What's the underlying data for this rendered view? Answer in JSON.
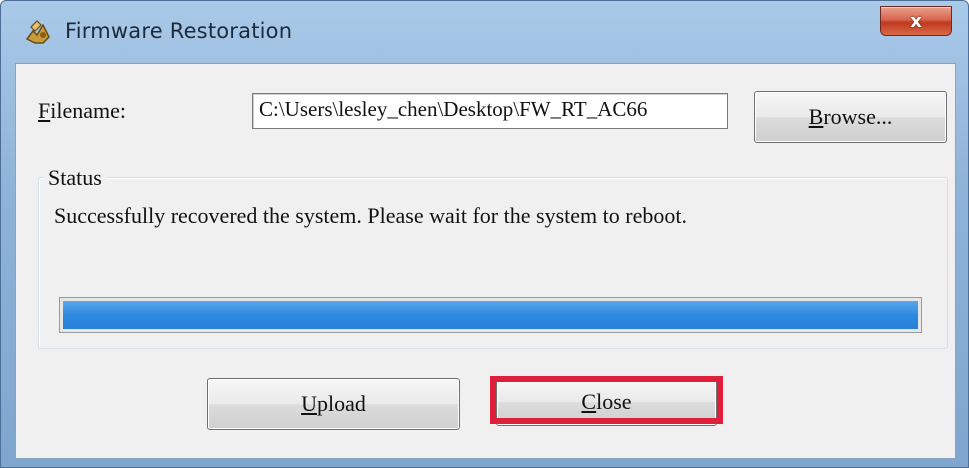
{
  "window": {
    "title": "Firmware Restoration",
    "close_symbol": "x",
    "icon": "firmware-restoration-app-icon"
  },
  "form": {
    "filename_label_first": "F",
    "filename_label_rest": "ilename:",
    "filename_value": "C:\\Users\\lesley_chen\\Desktop\\FW_RT_AC66",
    "browse_first": "B",
    "browse_rest": "rowse..."
  },
  "status": {
    "legend": "Status",
    "message": "Successfully recovered the system. Please wait for the system to reboot.",
    "progress_fraction": 1.0,
    "progress_color": "#2f8ae0"
  },
  "actions": {
    "upload_first": "U",
    "upload_rest": "pload",
    "close_first": "C",
    "close_rest": "lose",
    "highlight_color": "#e0203a"
  }
}
